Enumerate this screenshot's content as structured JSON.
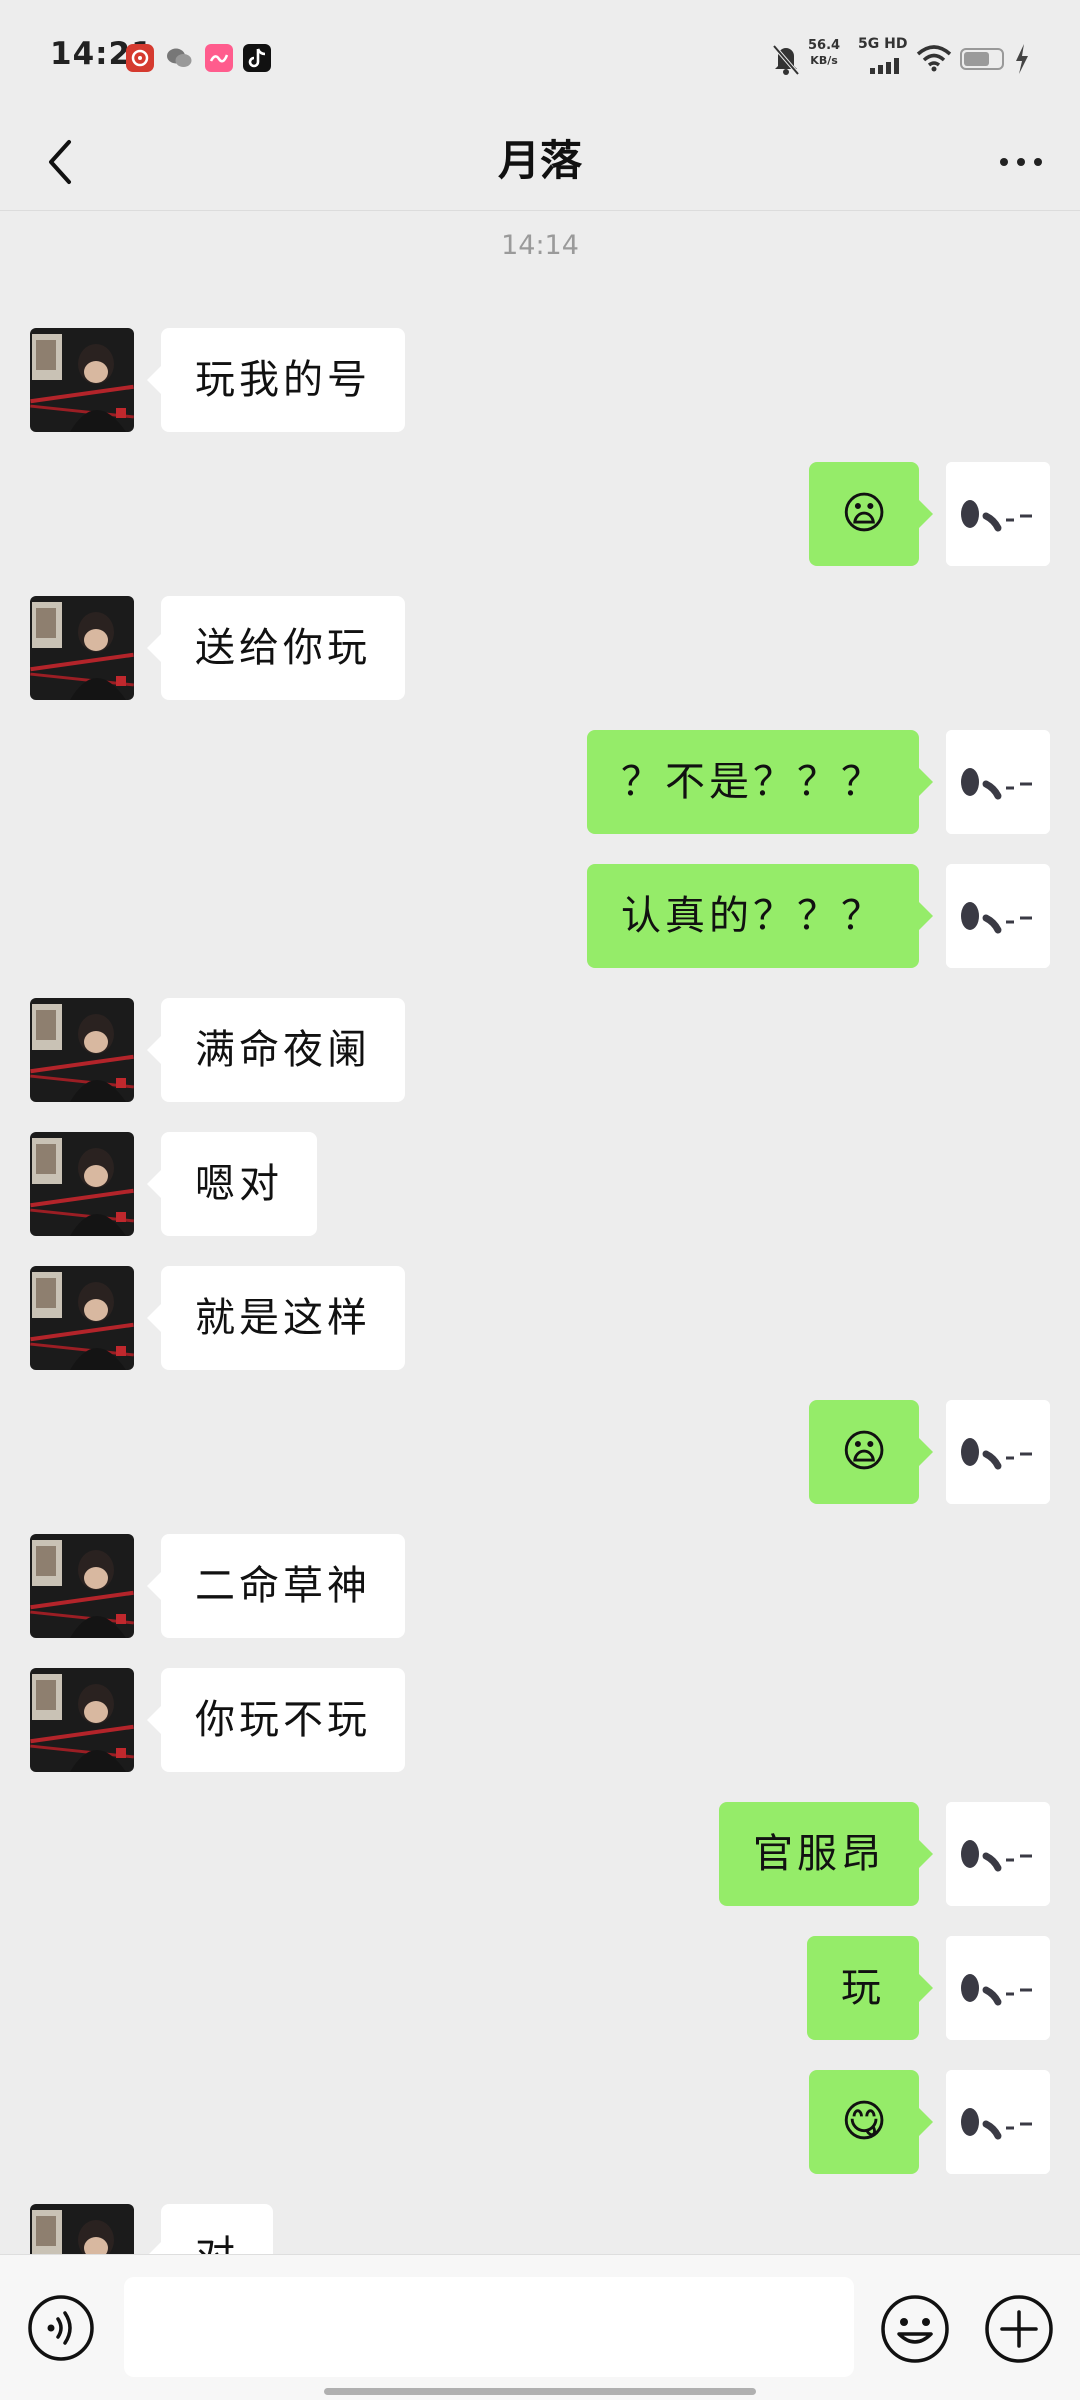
{
  "status_bar": {
    "time": "14:21",
    "net_speed_value": "56.4",
    "net_speed_unit": "KB/s",
    "network_type": "5G HD",
    "apps": [
      "netease-music-icon",
      "wechat-icon",
      "soul-icon",
      "tiktok-icon"
    ],
    "icons": [
      "mute-bell-icon",
      "signal-icon",
      "wifi-icon",
      "battery-icon",
      "charging-icon"
    ]
  },
  "header": {
    "back_icon": "chevron-left-icon",
    "title": "月落",
    "more_icon": "more-dots-icon"
  },
  "chat": {
    "timestamp": "14:14",
    "messages": [
      {
        "from": "them",
        "text": "玩我的号"
      },
      {
        "from": "me",
        "text": "😦"
      },
      {
        "from": "them",
        "text": "送给你玩"
      },
      {
        "from": "me",
        "text": "？不是？？？"
      },
      {
        "from": "me",
        "text": "认真的？？？"
      },
      {
        "from": "them",
        "text": "满命夜阑"
      },
      {
        "from": "them",
        "text": "嗯对"
      },
      {
        "from": "them",
        "text": "就是这样"
      },
      {
        "from": "me",
        "text": "😦"
      },
      {
        "from": "them",
        "text": "二命草神"
      },
      {
        "from": "them",
        "text": "你玩不玩"
      },
      {
        "from": "me",
        "text": "官服昂"
      },
      {
        "from": "me",
        "text": "玩"
      },
      {
        "from": "me",
        "text": "😋"
      },
      {
        "from": "them",
        "text": "对"
      }
    ]
  },
  "input_bar": {
    "voice_icon": "voice-icon",
    "text_value": "",
    "emoji_icon": "emoji-smile-icon",
    "plus_icon": "plus-circle-icon"
  },
  "colors": {
    "background": "#ededed",
    "outgoing_bubble": "#95ec69",
    "incoming_bubble": "#ffffff"
  }
}
